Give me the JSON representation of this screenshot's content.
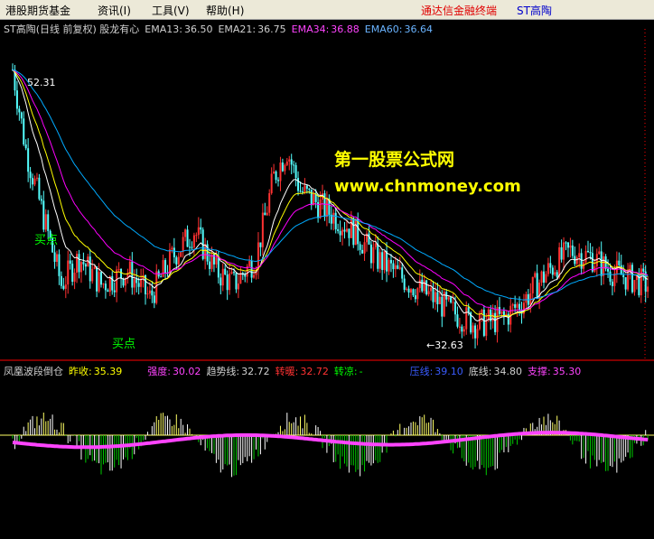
{
  "menu": {
    "items": [
      "港股期货基金",
      "资讯(I)",
      "工具(V)",
      "帮助(H)"
    ],
    "right_brand": "通达信金融终端",
    "right_stock": "ST高陶"
  },
  "price_header": {
    "prefix": "ST高陶(日线 前复权) 股龙有心",
    "ema13_label": "EMA13:",
    "ema13_value": "36.50",
    "ema21_label": "EMA21:",
    "ema21_value": "36.75",
    "ema34_label": "EMA34:",
    "ema34_value": "36.88",
    "ema60_label": "EMA60:",
    "ema60_value": "36.64"
  },
  "annotations": {
    "high_label": "52.31",
    "low_label": "←32.63",
    "buy1": "买点",
    "buy2": "买点"
  },
  "watermark": {
    "line1": "第一股票公式网",
    "line2": "www.chnmoney.com"
  },
  "indicator_header": {
    "name": "凤凰波段倒仓",
    "prev_close_label": "昨收:",
    "prev_close_value": "35.39",
    "strength_label": "强度:",
    "strength_value": "30.02",
    "trend_label": "趋势线:",
    "trend_value": "32.72",
    "turn_warm_label": "转暖:",
    "turn_warm_value": "32.72",
    "turn_cool_label": "转凉:",
    "turn_cool_value": "-",
    "pressure_label": "压线:",
    "pressure_value": "39.10",
    "bottom_label": "底线:",
    "bottom_value": "34.80",
    "support_label": "支撑:",
    "support_value": "35.30"
  },
  "colors": {
    "up": "#ff3232",
    "down": "#54ffff",
    "ema13": "#ffffff",
    "ema21": "#ffff00",
    "ema34": "#ff00ff",
    "ema60": "#00aaff",
    "accent_magenta": "#ff44ff"
  },
  "chart_data": {
    "type": "candlestick",
    "series_summary": {
      "labeled_high": 52.31,
      "labeled_low": 32.63
    }
  }
}
